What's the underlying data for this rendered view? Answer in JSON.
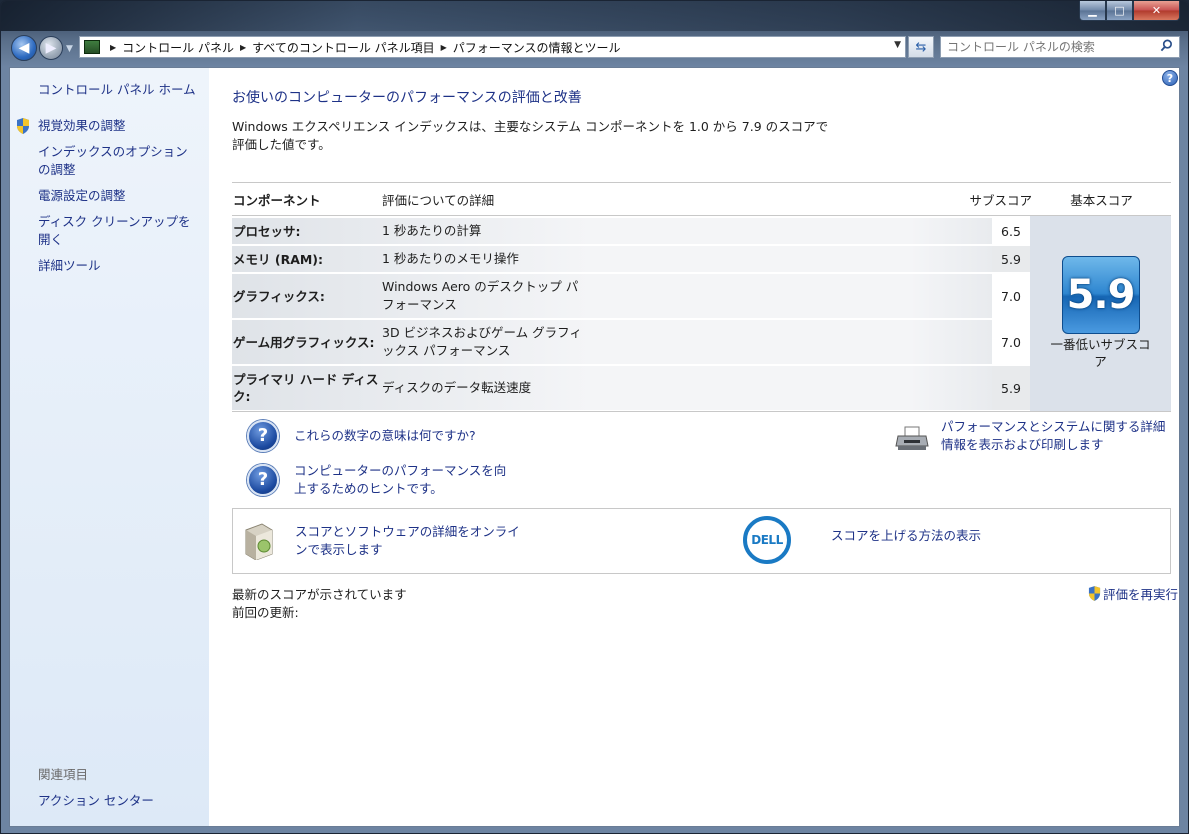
{
  "window": {
    "controls": {
      "minimize": "▁",
      "maximize": "□",
      "close": "✕"
    }
  },
  "nav": {
    "breadcrumbs": [
      "コントロール パネル",
      "すべてのコントロール パネル項目",
      "パフォーマンスの情報とツール"
    ],
    "search_placeholder": "コントロール パネルの検索"
  },
  "sidebar": {
    "home": "コントロール パネル ホーム",
    "items": [
      "視覚効果の調整",
      "インデックスのオプションの調整",
      "電源設定の調整",
      "ディスク クリーンアップを開く",
      "詳細ツール"
    ],
    "related_title": "関連項目",
    "related_items": [
      "アクション センター"
    ]
  },
  "main": {
    "title": "お使いのコンピューターのパフォーマンスの評価と改善",
    "description": "Windows エクスペリエンス インデックスは、主要なシステム コンポーネントを 1.0 から 7.9 のスコアで評価した値です。",
    "table": {
      "headers": {
        "component": "コンポーネント",
        "detail": "評価についての詳細",
        "subscore": "サブスコア",
        "basescore": "基本スコア"
      },
      "rows": [
        {
          "component": "プロセッサ:",
          "detail": "1 秒あたりの計算",
          "subscore": "6.5"
        },
        {
          "component": "メモリ (RAM):",
          "detail": "1 秒あたりのメモリ操作",
          "subscore": "5.9"
        },
        {
          "component": "グラフィックス:",
          "detail": "Windows Aero のデスクトップ パフォーマンス",
          "subscore": "7.0"
        },
        {
          "component": "ゲーム用グラフィックス:",
          "detail": "3D ビジネスおよびゲーム グラフィックス パフォーマンス",
          "subscore": "7.0"
        },
        {
          "component": "プライマリ ハード ディスク:",
          "detail": "ディスクのデータ転送速度",
          "subscore": "5.9"
        }
      ],
      "base_score": "5.9",
      "base_label": "一番低いサブスコア"
    },
    "links": {
      "what_numbers": "これらの数字の意味は何ですか?",
      "tips": "コンピューターのパフォーマンスを向上するためのヒントです。",
      "print_details": "パフォーマンスとシステムに関する詳細情報を表示および印刷します",
      "online_details": "スコアとソフトウェアの詳細をオンラインで表示します",
      "raise_score": "スコアを上げる方法の表示",
      "rerun": "評価を再実行"
    },
    "dell_logo_text": "DELL",
    "status": {
      "latest": "最新のスコアが示されています",
      "last_update_label": "前回の更新:"
    }
  }
}
